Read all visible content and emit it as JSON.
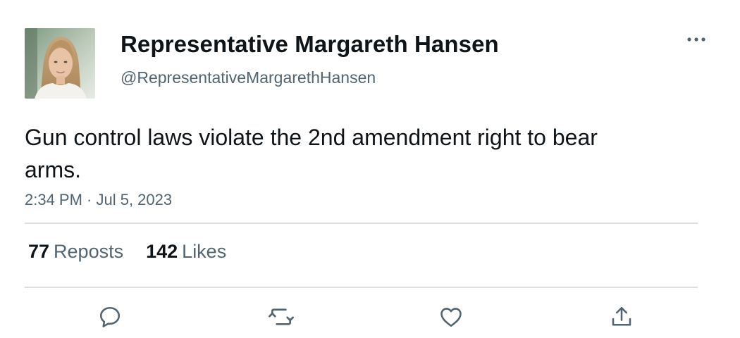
{
  "author": {
    "display_name": "Representative Margareth Hansen",
    "handle": "@RepresentativeMargarethHansen"
  },
  "tweet": {
    "text": "Gun control laws violate the 2nd amendment right to bear arms.",
    "timestamp": "2:34 PM · Jul 5, 2023"
  },
  "stats": {
    "reposts_count": "77",
    "reposts_label": "Reposts",
    "likes_count": "142",
    "likes_label": "Likes"
  },
  "icons": {
    "more": "more-horizontal-icon",
    "reply": "reply-icon",
    "repost": "repost-icon",
    "like": "heart-icon",
    "share": "share-icon",
    "icon_color": "#536471"
  },
  "colors": {
    "text_primary": "#0f1419",
    "text_secondary": "#536471",
    "divider": "#dcdfe2"
  }
}
